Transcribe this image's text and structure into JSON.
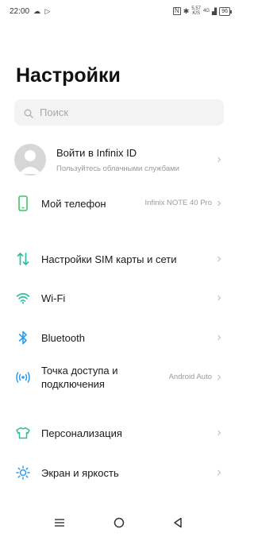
{
  "status_bar": {
    "time": "22:00",
    "left_icons": [
      "cloud-icon",
      "play-store-icon"
    ],
    "net_speed_value": "5,57",
    "net_speed_unit": "K/S",
    "network": "4G",
    "battery": "96"
  },
  "header": {
    "title": "Настройки"
  },
  "search": {
    "placeholder": "Поиск"
  },
  "account": {
    "title": "Войти в Infinix ID",
    "subtitle": "Пользуйтесь облачными службами"
  },
  "settings": {
    "my_phone": {
      "label": "Мой телефон",
      "value": "Infinix NOTE 40 Pro",
      "icon": "phone-icon"
    },
    "sim": {
      "label": "Настройки SIM карты и сети",
      "icon": "sim-arrows-icon"
    },
    "wifi": {
      "label": "Wi-Fi",
      "icon": "wifi-icon"
    },
    "bluetooth": {
      "label": "Bluetooth",
      "icon": "bluetooth-icon"
    },
    "hotspot": {
      "label_line1": "Точка доступа и",
      "label_line2": "подключения",
      "value": "Android Auto",
      "icon": "hotspot-icon"
    },
    "personalization": {
      "label": "Персонализация",
      "icon": "shirt-icon"
    },
    "display": {
      "label": "Экран и яркость",
      "icon": "brightness-icon"
    }
  },
  "colors": {
    "accent_green": "#3cc46a",
    "accent_blue": "#2a9df4",
    "accent_teal": "#2bbfa0",
    "text_secondary": "#9a9a9a"
  },
  "nav_bar": {
    "buttons": [
      "menu-icon",
      "home-icon",
      "back-icon"
    ]
  }
}
